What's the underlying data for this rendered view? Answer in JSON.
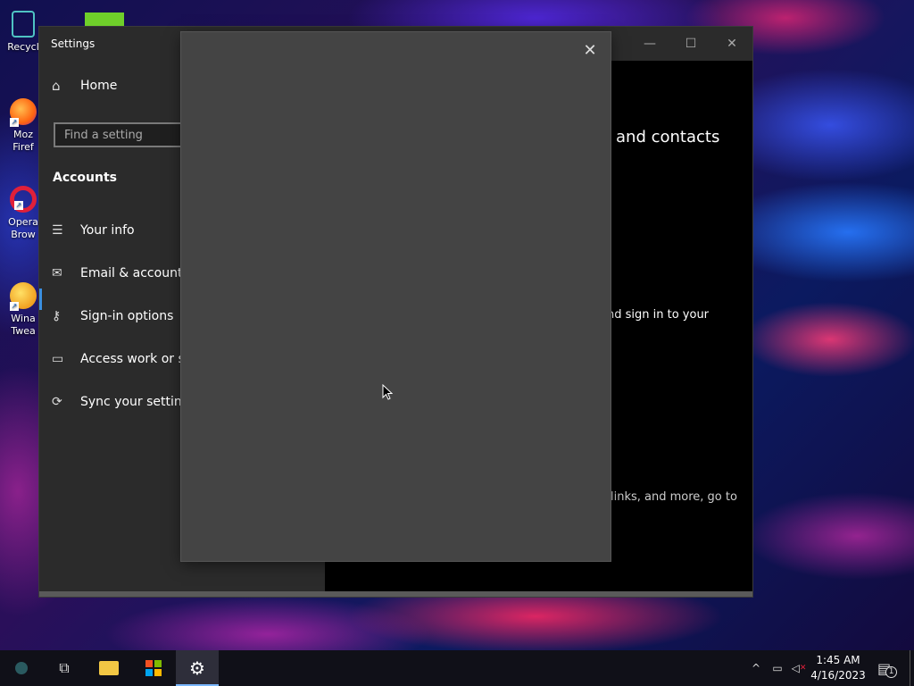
{
  "desktop": {
    "icons": [
      {
        "label": "Recycl",
        "icon": "recycle-bin-icon"
      },
      {
        "label": "Moz\nFiref",
        "icon": "firefox-icon"
      },
      {
        "label": "Opera\nBrow",
        "icon": "opera-icon"
      },
      {
        "label": "Wina\nTwea",
        "icon": "winaero-tweaker-icon"
      }
    ]
  },
  "settings": {
    "title": "Settings",
    "home_label": "Home",
    "search_placeholder": "Find a setting",
    "section": "Accounts",
    "nav": [
      {
        "label": "Your info",
        "icon": "person-card-icon"
      },
      {
        "label": "Email & accounts",
        "icon": "mail-icon"
      },
      {
        "label": "Sign-in options",
        "icon": "key-icon"
      },
      {
        "label": "Access work or sch",
        "icon": "briefcase-icon"
      },
      {
        "label": "Sync your settings",
        "icon": "sync-icon"
      }
    ],
    "content": {
      "heading_fragment": "and contacts",
      "text1_fragment": "nd sign in to your",
      "text2_fragment": "links, and more, go to"
    }
  },
  "dialog": {
    "close_icon": "close-icon"
  },
  "taskbar": {
    "clock_time": "1:45 AM",
    "clock_date": "4/16/2023",
    "notification_count": "1",
    "accent": "#7ab7ff"
  }
}
